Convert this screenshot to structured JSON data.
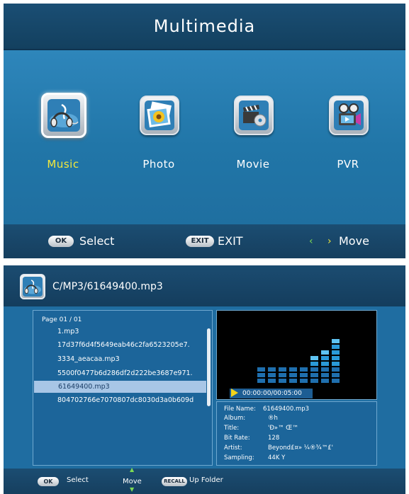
{
  "menu": {
    "title": "Multimedia",
    "items": [
      {
        "label": "Music",
        "icon": "music-headphones-icon",
        "selected": true
      },
      {
        "label": "Photo",
        "icon": "photo-sunflower-icon",
        "selected": false
      },
      {
        "label": "Movie",
        "icon": "movie-clapper-icon",
        "selected": false
      },
      {
        "label": "PVR",
        "icon": "pvr-camera-icon",
        "selected": false
      }
    ],
    "footer": {
      "ok_key": "OK",
      "ok_label": "Select",
      "exit_key": "EXIT",
      "exit_label": "EXIT",
      "move_label": "Move"
    },
    "colors": {
      "accent": "#f3e83b",
      "background": "#2176a8"
    }
  },
  "browser": {
    "path": "C/MP3/61649400.mp3",
    "page_label": "Page  01 / 01",
    "files": [
      {
        "name": "1.mp3"
      },
      {
        "name": "17d37f6d4f5649eab46c2fa6523205e7."
      },
      {
        "name": "3334_aeacaa.mp3"
      },
      {
        "name": "5500f0477b6d286df2d222be3687e971."
      },
      {
        "name": "61649400.mp3",
        "selected": true
      },
      {
        "name": "804702766e7070807dc8030d3a0b609d"
      }
    ],
    "playback": {
      "time": "00:00:00/00:05:00"
    },
    "equalizer_levels": [
      3,
      3,
      3,
      3,
      3,
      5,
      6,
      8
    ],
    "info": [
      {
        "key": "File Name:",
        "value": "61649400.mp3"
      },
      {
        "key": "Album:",
        "value": "®h"
      },
      {
        "key": "Title:",
        "value": "'Ð»™ Œ™"
      },
      {
        "key": "Bit Rate:",
        "value": "128"
      },
      {
        "key": "Artist:",
        "value": "Beyond£¤» ¼®¾™£'"
      },
      {
        "key": "Sampling:",
        "value": "44K        Y"
      }
    ],
    "footer": {
      "ok_key": "OK",
      "ok_label": "Select",
      "move_label": "Move",
      "recall_key": "RECALL",
      "recall_label": "Up Folder"
    },
    "colors": {
      "selected_row": "#a8c6e6",
      "play_indicator": "#f3d31b",
      "eq_bar": "#2a9ad8"
    }
  }
}
